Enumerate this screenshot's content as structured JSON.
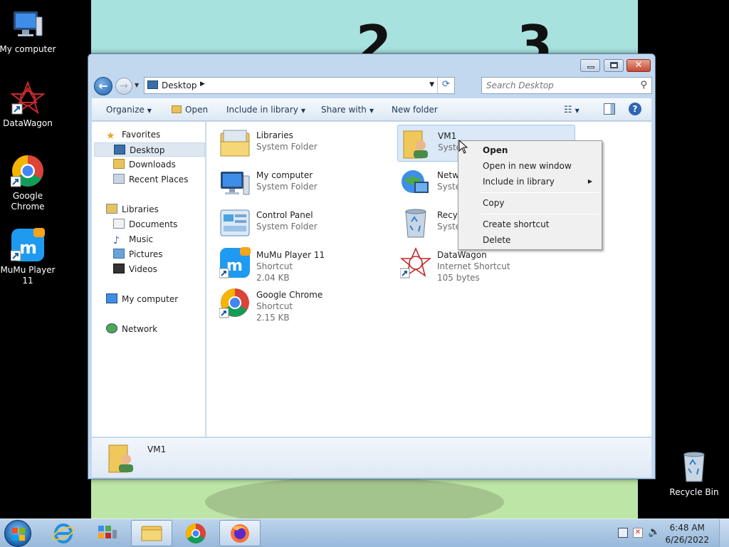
{
  "wallpaper": {
    "numbers": [
      "2",
      "3"
    ]
  },
  "desktop_icons": [
    {
      "label": "My computer"
    },
    {
      "label": "DataWagon"
    },
    {
      "label": "Google Chrome"
    },
    {
      "label": "MuMu Player 11"
    },
    {
      "label": "Recycle Bin"
    }
  ],
  "window": {
    "address": {
      "crumb": "Desktop"
    },
    "search": {
      "placeholder": "Search Desktop"
    },
    "toolbar": {
      "organize": "Organize",
      "open": "Open",
      "include_in_library": "Include in library",
      "share_with": "Share with",
      "new_folder": "New folder"
    },
    "nav": {
      "favorites": "Favorites",
      "desktop": "Desktop",
      "downloads": "Downloads",
      "recent_places": "Recent Places",
      "libraries": "Libraries",
      "documents": "Documents",
      "music": "Music",
      "pictures": "Pictures",
      "videos": "Videos",
      "my_computer": "My computer",
      "network": "Network"
    },
    "items": [
      {
        "name": "Libraries",
        "type": "System Folder",
        "size": ""
      },
      {
        "name": "My computer",
        "type": "System Folder",
        "size": ""
      },
      {
        "name": "Control Panel",
        "type": "System Folder",
        "size": ""
      },
      {
        "name": "MuMu Player 11",
        "type": "Shortcut",
        "size": "2.04 KB"
      },
      {
        "name": "Google Chrome",
        "type": "Shortcut",
        "size": "2.15 KB"
      },
      {
        "name": "VM1",
        "type": "System Folder",
        "size": ""
      },
      {
        "name": "Network",
        "type": "System Folder",
        "size": ""
      },
      {
        "name": "Recycle Bin",
        "type": "System Folder",
        "size": ""
      },
      {
        "name": "DataWagon",
        "type": "Internet Shortcut",
        "size": "105 bytes"
      }
    ],
    "details": {
      "name": "VM1"
    }
  },
  "context_menu": {
    "open": "Open",
    "open_new_window": "Open in new window",
    "include_in_library": "Include in library",
    "copy": "Copy",
    "create_shortcut": "Create shortcut",
    "delete": "Delete"
  },
  "taskbar": {
    "time": "6:48 AM",
    "date": "6/26/2022"
  }
}
